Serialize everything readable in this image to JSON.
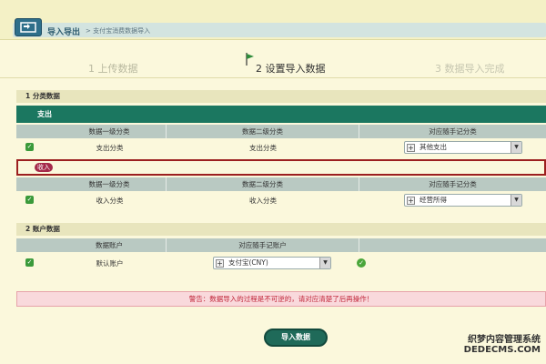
{
  "header": {
    "title": "导入导出",
    "breadcrumb": "> 支付宝消费数据导入"
  },
  "steps": [
    {
      "label": "1 上传数据",
      "state": "done"
    },
    {
      "label": "2 设置导入数据",
      "state": "active"
    },
    {
      "label": "3 数据导入完成",
      "state": "todo"
    }
  ],
  "section1": {
    "title": "1 分类数据",
    "expense_label": "支出",
    "income_label": "收入",
    "columns": [
      "数据一级分类",
      "数据二级分类",
      "对应随手记分类"
    ],
    "expense_row": {
      "cat1": "支出分类",
      "cat2": "支出分类",
      "mapped": "其他支出"
    },
    "income_row": {
      "cat1": "收入分类",
      "cat2": "收入分类",
      "mapped": "经营所得"
    }
  },
  "section2": {
    "title": "2 账户数据",
    "columns": [
      "数据账户",
      "对应随手记账户"
    ],
    "row": {
      "account": "默认账户",
      "mapped": "支付宝(CNY)"
    }
  },
  "warning": "警告：数据导入的过程是不可逆的，请对应清楚了后再操作！",
  "import_button": "导入数据",
  "watermark": {
    "line1": "织梦内容管理系统",
    "line2": "DEDECMS.COM"
  },
  "colors": {
    "accent_green": "#1b7760",
    "warning_red": "#c0263a",
    "background": "#fbf8dc"
  },
  "icons": [
    "import-export-icon",
    "flag-icon",
    "check-icon",
    "plus-icon",
    "dropdown-arrow-icon",
    "ok-icon"
  ]
}
